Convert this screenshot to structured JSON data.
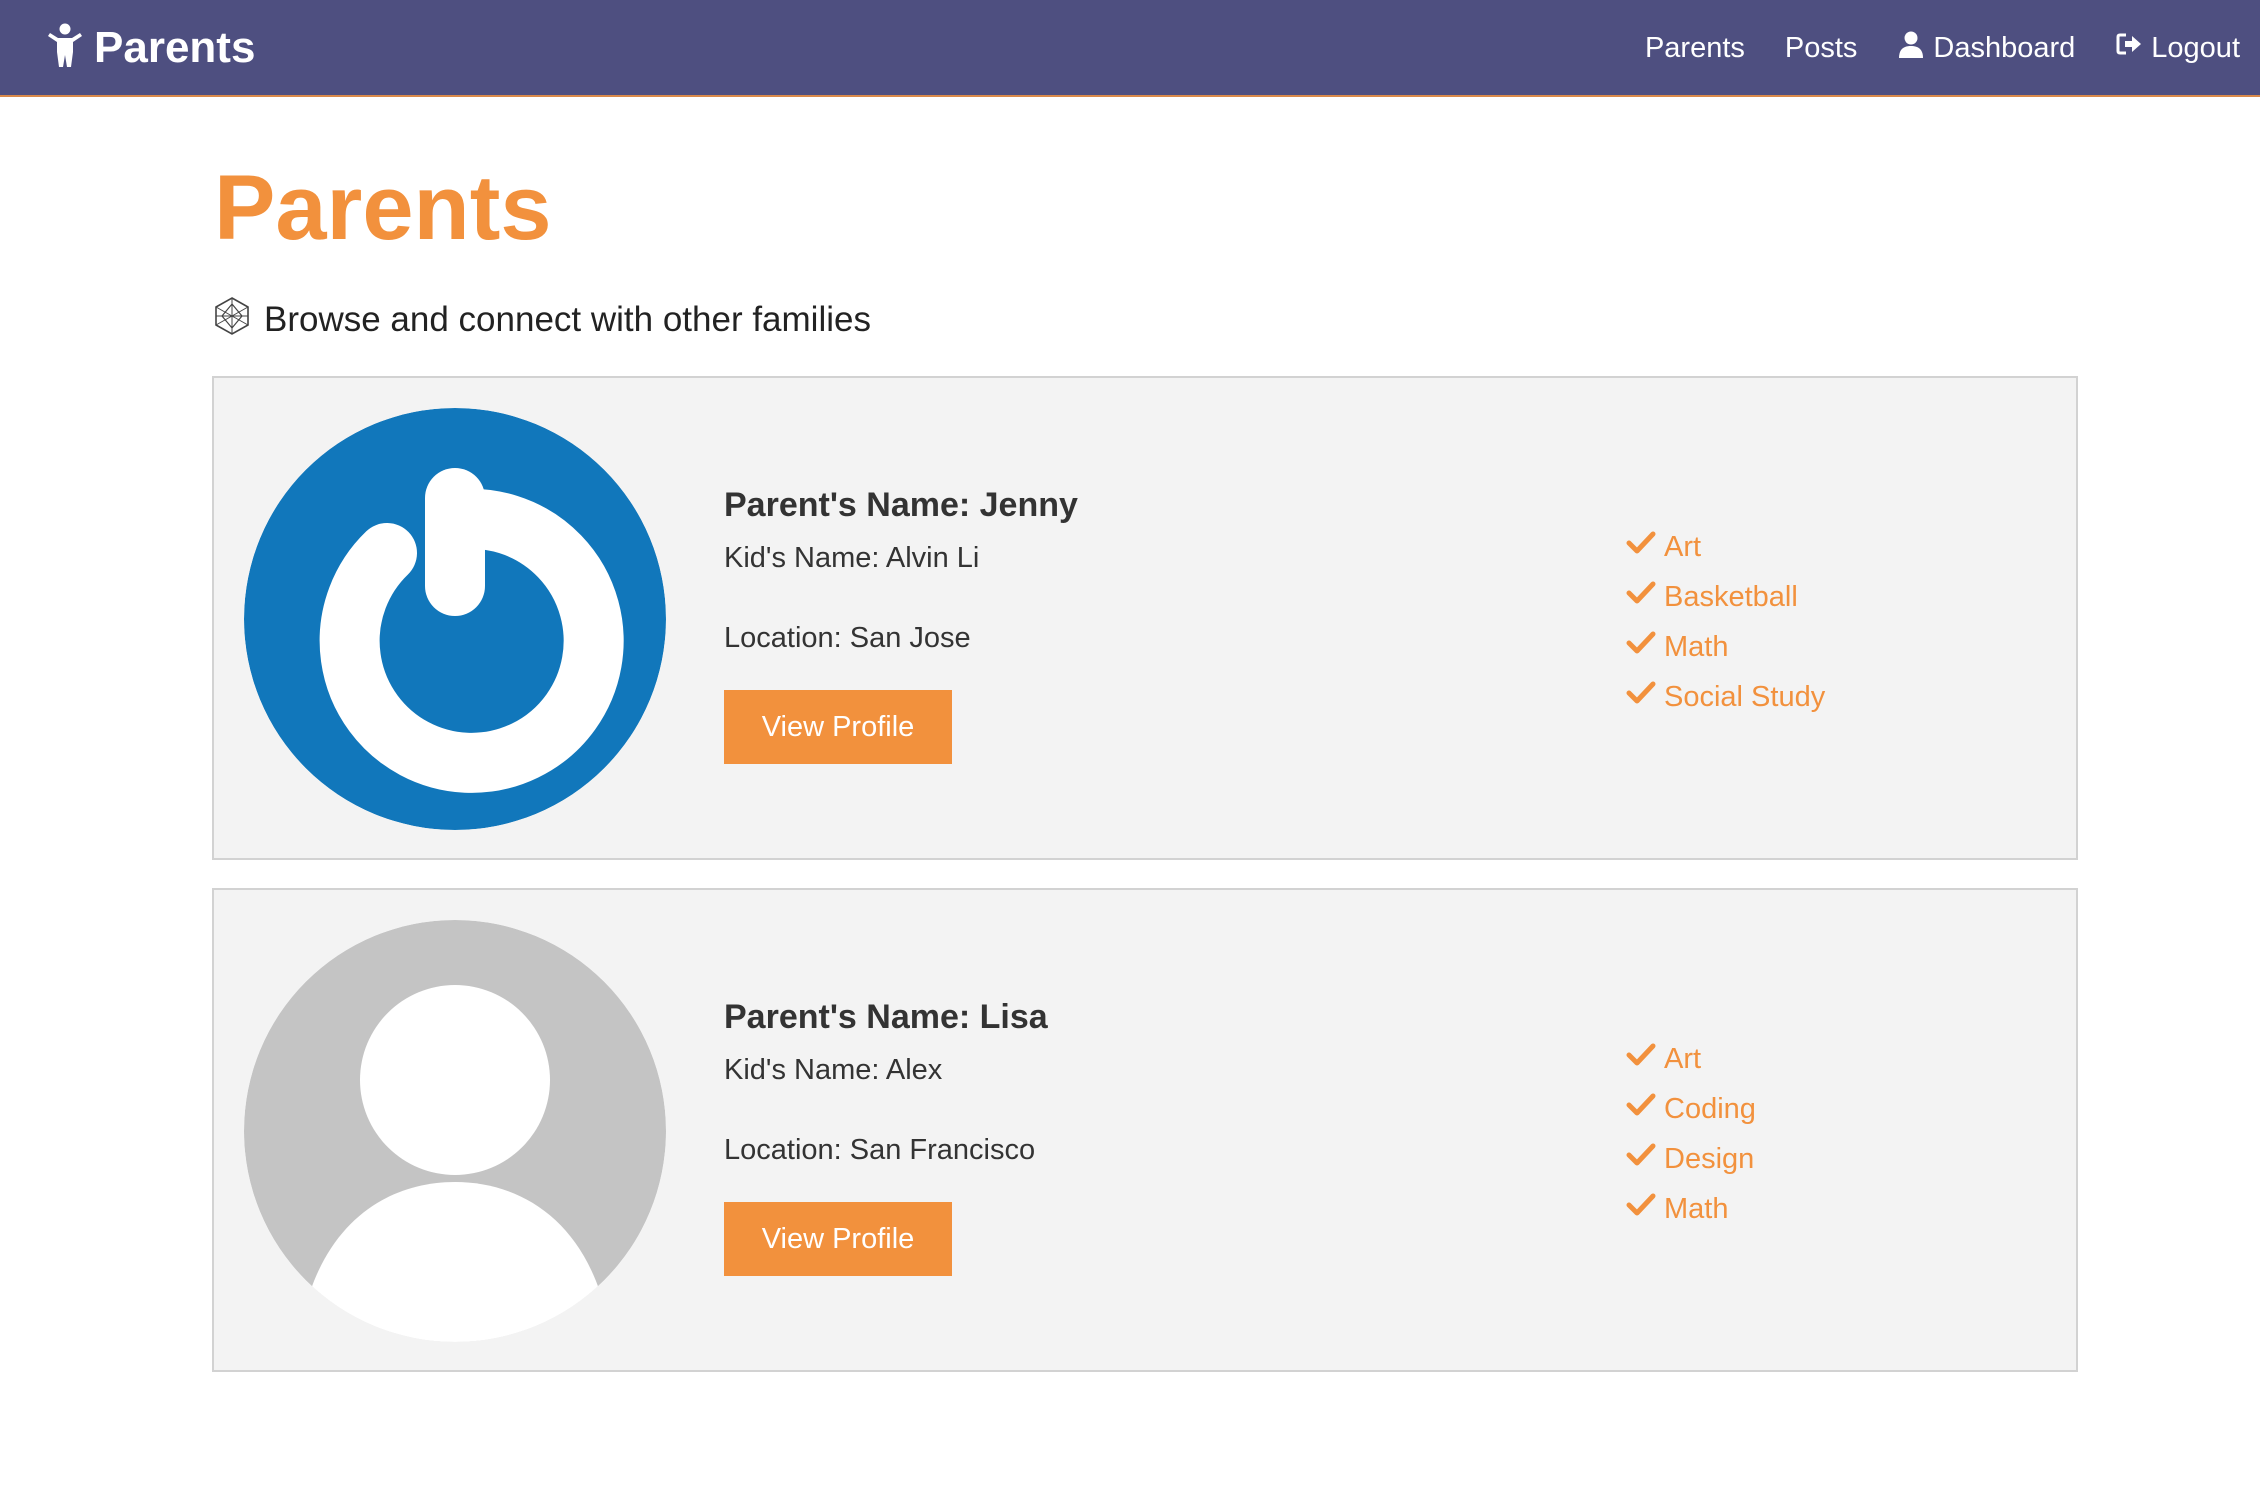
{
  "colors": {
    "navbar": "#4e4f80",
    "accent": "#f2913d",
    "card_bg": "#f3f3f3",
    "avatar_blue": "#1177bb",
    "avatar_gray": "#c4c4c4"
  },
  "navbar": {
    "brand": {
      "icon": "child-icon",
      "title": "Parents"
    },
    "links": [
      {
        "label": "Parents"
      },
      {
        "label": "Posts"
      },
      {
        "label": "Dashboard",
        "icon": "user-icon"
      },
      {
        "label": "Logout",
        "icon": "sign-out-icon"
      }
    ]
  },
  "page": {
    "title": "Parents",
    "subtitle": "Browse and connect with other families",
    "subtitle_icon": "cube-wireframe-icon"
  },
  "parents": [
    {
      "avatar": "power-logo-avatar",
      "name_label": "Parent's Name: Jenny",
      "kid_label": "Kid's Name: Alvin Li",
      "location_label": "Location: San Jose",
      "button_label": "View Profile",
      "interests": [
        "Art",
        "Basketball",
        "Math",
        "Social Study"
      ]
    },
    {
      "avatar": "default-person-avatar",
      "name_label": "Parent's Name: Lisa",
      "kid_label": "Kid's Name: Alex",
      "location_label": "Location: San Francisco",
      "button_label": "View Profile",
      "interests": [
        "Art",
        "Coding",
        "Design",
        "Math"
      ]
    }
  ]
}
